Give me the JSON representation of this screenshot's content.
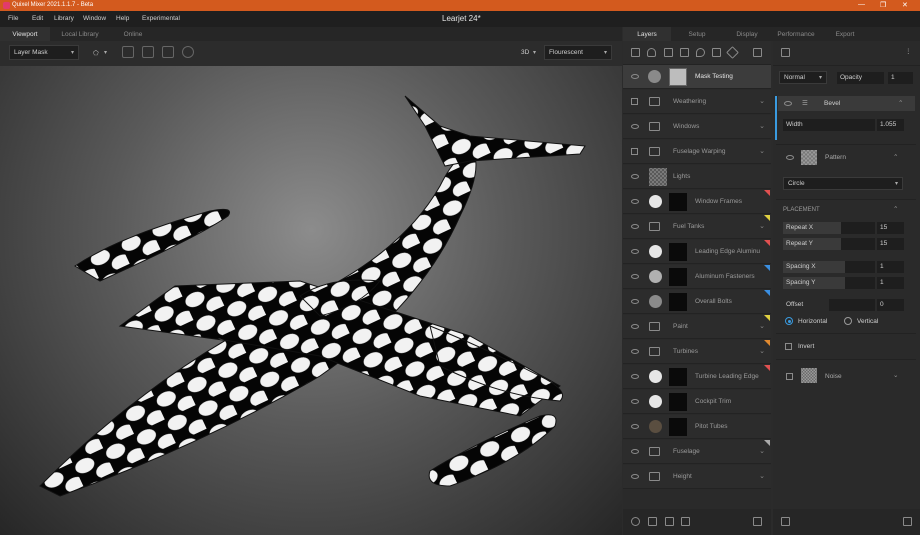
{
  "titlebar": {
    "app_title": "Quixel Mixer 2021.1.1.7 - Beta"
  },
  "menu": [
    "File",
    "Edit",
    "Library",
    "Window",
    "Help",
    "Experimental"
  ],
  "document_title": "Learjet 24*",
  "left_tabs": [
    "Viewport",
    "Local Library",
    "Online"
  ],
  "right_tabs": [
    "Layers",
    "Setup",
    "Display",
    "Performance",
    "Export"
  ],
  "viewport_toolbar": {
    "mask_dropdown": "Layer Mask",
    "view_mode": "3D",
    "lighting": "Flourescent"
  },
  "layers": [
    {
      "name": "Mask Testing",
      "kind": "smart",
      "selected": true
    },
    {
      "name": "Weathering",
      "kind": "folder",
      "toggle": "checkbox"
    },
    {
      "name": "Windows",
      "kind": "folder"
    },
    {
      "name": "Fuselage Warping",
      "kind": "folder",
      "toggle": "checkbox"
    },
    {
      "name": "Lights",
      "kind": "checker"
    },
    {
      "name": "Window Frames",
      "kind": "mask",
      "flag": "#e05050"
    },
    {
      "name": "Fuel Tanks",
      "kind": "folder",
      "flag": "#e0d040"
    },
    {
      "name": "Leading Edge Aluminu",
      "kind": "mask",
      "flag": "#e05050"
    },
    {
      "name": "Aluminum Fasteners",
      "kind": "mask-grey",
      "flag": "#3a8ee0"
    },
    {
      "name": "Overall Bolts",
      "kind": "mask-grey",
      "flag": "#3a8ee0"
    },
    {
      "name": "Paint",
      "kind": "folder",
      "flag": "#e0d040"
    },
    {
      "name": "Turbines",
      "kind": "folder",
      "flag": "#e08a30"
    },
    {
      "name": "Turbine Leading Edge",
      "kind": "mask",
      "flag": "#e05050"
    },
    {
      "name": "Cockpit Trim",
      "kind": "mask"
    },
    {
      "name": "Pitot Tubes",
      "kind": "mask-dark"
    },
    {
      "name": "Fuselage",
      "kind": "folder",
      "flag": "#aaaaaa"
    },
    {
      "name": "Height",
      "kind": "folder"
    }
  ],
  "props": {
    "blend_mode": "Normal",
    "opacity_label": "Opacity",
    "opacity_value": "1",
    "bevel_label": "Bevel",
    "width_label": "Width",
    "width_value": "1.055",
    "pattern_label": "Pattern",
    "pattern_shape": "Circle",
    "placement_label": "PLACEMENT",
    "repeat_x_label": "Repeat X",
    "repeat_x_value": "15",
    "repeat_y_label": "Repeat Y",
    "repeat_y_value": "15",
    "spacing_x_label": "Spacing X",
    "spacing_x_value": "1",
    "spacing_y_label": "Spacing Y",
    "spacing_y_value": "1",
    "offset_label": "Offset",
    "offset_value": "0",
    "horizontal_label": "Horizontal",
    "vertical_label": "Vertical",
    "invert_label": "Invert",
    "noise_label": "Noise"
  }
}
